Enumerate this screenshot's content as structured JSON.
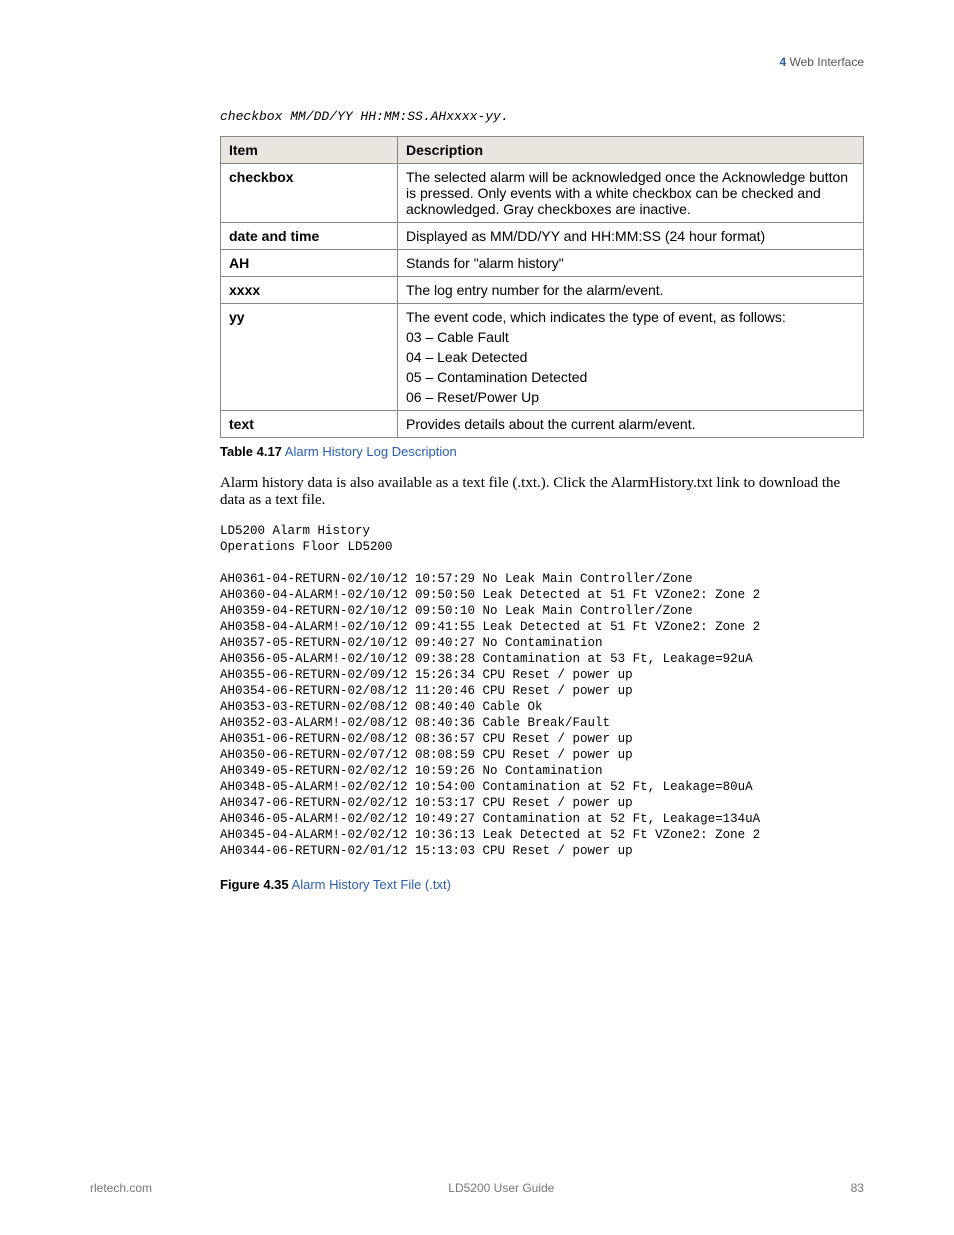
{
  "header": {
    "chapter_num": "4",
    "chapter_title": "Web Interface"
  },
  "format_line": "checkbox MM/DD/YY HH:MM:SS.AHxxxx-yy.",
  "table": {
    "head_item": "Item",
    "head_desc": "Description",
    "rows": [
      {
        "item": "checkbox",
        "desc": [
          "The selected alarm will be acknowledged once the Acknowledge button is pressed. Only events with a white checkbox can be checked and acknowledged. Gray checkboxes are inactive."
        ]
      },
      {
        "item": "date and time",
        "desc": [
          "Displayed as MM/DD/YY and HH:MM:SS (24 hour format)"
        ]
      },
      {
        "item": "AH",
        "desc": [
          "Stands for \"alarm history\""
        ]
      },
      {
        "item": "xxxx",
        "desc": [
          "The log entry number for the alarm/event."
        ]
      },
      {
        "item": "yy",
        "desc": [
          "The event code, which indicates the type of event, as follows:",
          "03 – Cable Fault",
          "04 – Leak Detected",
          "05 – Contamination Detected",
          "06 – Reset/Power Up"
        ]
      },
      {
        "item": "text",
        "desc": [
          "Provides details about the current alarm/event."
        ]
      }
    ]
  },
  "table_caption": {
    "strong": "Table 4.17",
    "link": " Alarm History Log Description"
  },
  "body_paragraph": "Alarm history data is also available as a text file (.txt.). Click the AlarmHistory.txt link to download the data as a text file.",
  "log_title1": "LD5200 Alarm History",
  "log_title2": "Operations Floor LD5200",
  "log_lines": [
    "AH0361-04-RETURN-02/10/12 10:57:29 No Leak Main Controller/Zone",
    "AH0360-04-ALARM!-02/10/12 09:50:50 Leak Detected at 51 Ft VZone2: Zone 2",
    "AH0359-04-RETURN-02/10/12 09:50:10 No Leak Main Controller/Zone",
    "AH0358-04-ALARM!-02/10/12 09:41:55 Leak Detected at 51 Ft VZone2: Zone 2",
    "AH0357-05-RETURN-02/10/12 09:40:27 No Contamination",
    "AH0356-05-ALARM!-02/10/12 09:38:28 Contamination at 53 Ft, Leakage=92uA",
    "AH0355-06-RETURN-02/09/12 15:26:34 CPU Reset / power up",
    "AH0354-06-RETURN-02/08/12 11:20:46 CPU Reset / power up",
    "AH0353-03-RETURN-02/08/12 08:40:40 Cable Ok",
    "AH0352-03-ALARM!-02/08/12 08:40:36 Cable Break/Fault",
    "AH0351-06-RETURN-02/08/12 08:36:57 CPU Reset / power up",
    "AH0350-06-RETURN-02/07/12 08:08:59 CPU Reset / power up",
    "AH0349-05-RETURN-02/02/12 10:59:26 No Contamination",
    "AH0348-05-ALARM!-02/02/12 10:54:00 Contamination at 52 Ft, Leakage=80uA",
    "AH0347-06-RETURN-02/02/12 10:53:17 CPU Reset / power up",
    "AH0346-05-ALARM!-02/02/12 10:49:27 Contamination at 52 Ft, Leakage=134uA",
    "AH0345-04-ALARM!-02/02/12 10:36:13 Leak Detected at 52 Ft VZone2: Zone 2",
    "AH0344-06-RETURN-02/01/12 15:13:03 CPU Reset / power up"
  ],
  "figure_caption": {
    "strong": "Figure 4.35",
    "link": " Alarm History Text File (.txt)"
  },
  "footer": {
    "left": "rletech.com",
    "center": "LD5200 User Guide",
    "right": "83"
  }
}
